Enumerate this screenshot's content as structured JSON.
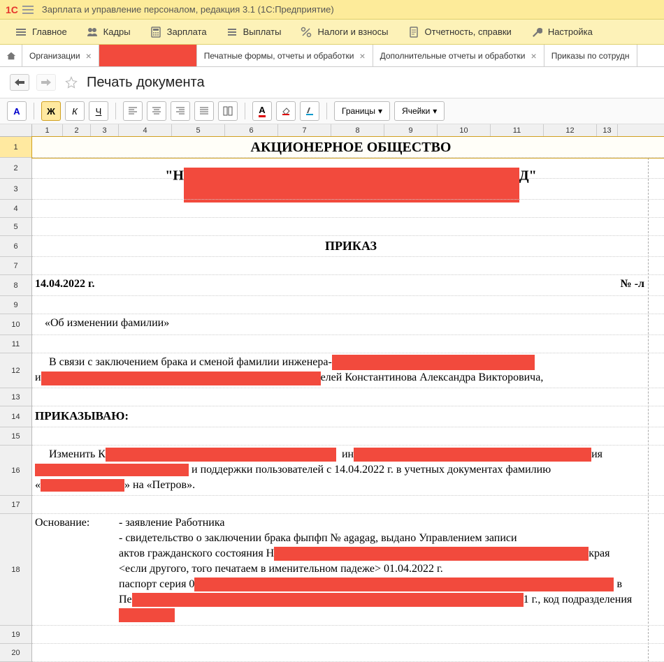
{
  "app": {
    "logo": "1C",
    "title": "Зарплата и управление персоналом, редакция 3.1  (1С:Предприятие)"
  },
  "mainmenu": [
    {
      "icon": "menu",
      "label": "Главное"
    },
    {
      "icon": "people",
      "label": "Кадры"
    },
    {
      "icon": "calc",
      "label": "Зарплата"
    },
    {
      "icon": "list",
      "label": "Выплаты"
    },
    {
      "icon": "percent",
      "label": "Налоги и взносы"
    },
    {
      "icon": "doc",
      "label": "Отчетность, справки"
    },
    {
      "icon": "wrench",
      "label": "Настройка"
    }
  ],
  "tabs": [
    {
      "label": "Организации",
      "closable": true,
      "active": false
    },
    {
      "label": "",
      "closable": false,
      "active": true,
      "redacted": true
    },
    {
      "label": "Печатные формы, отчеты и обработки",
      "closable": true,
      "active": false
    },
    {
      "label": "Дополнительные отчеты и обработки",
      "closable": true,
      "active": false
    },
    {
      "label": "Приказы по сотрудн",
      "closable": false,
      "active": false
    }
  ],
  "page": {
    "title": "Печать документа"
  },
  "toolbar": {
    "font_a": "A",
    "bold": "Ж",
    "italic": "К",
    "underline": "Ч",
    "borders": "Границы",
    "cells": "Ячейки"
  },
  "columns": [
    "1",
    "2",
    "3",
    "4",
    "5",
    "6",
    "7",
    "8",
    "9",
    "10",
    "11",
    "12",
    "13"
  ],
  "rows": [
    "1",
    "2",
    "3",
    "4",
    "5",
    "6",
    "7",
    "8",
    "9",
    "10",
    "11",
    "12",
    "13",
    "14",
    "15",
    "16",
    "17",
    "18",
    "19",
    "20"
  ],
  "doc": {
    "org_line1": "АКЦИОНЕРНОЕ ОБЩЕСТВО",
    "org_line2_before": "\"Н",
    "org_line2_after": "Д\"",
    "heading": "ПРИКАЗ",
    "date": "14.04.2022 г.",
    "number_label": "№ -л",
    "subject": "«Об изменении фамилии»",
    "para1_a": "В  связи  с  заключением  брака  и  сменой  фамилии  инженера-",
    "para1_b": "и",
    "para1_c": "елей Константинова Александра Викторовича,",
    "command": "ПРИКАЗЫВАЮ:",
    "para2_a": "Изменить  К",
    "para2_b": "ин",
    "para2_c": "ия",
    "para2_d": " и поддержки пользователей с 14.04.2022 г. в учетных документах фамилию",
    "para2_e": "«",
    "para2_f": "» на «Петров».",
    "basis_label": "Основание:",
    "basis1": "- заявление Работника",
    "basis2_a": "- свидетельство  о  заключении  брака  фыпфп  №  agagag,  выдано  Управлением  записи",
    "basis2_b": "актов  гражданского  состояния  Н",
    "basis2_c": "края",
    "basis2_d": "<если другого, того печатаем в именительном падеже> 01.04.2022 г.",
    "basis3_a": "паспорт  серия  0",
    "basis3_b": " в",
    "basis3_c": "Пе",
    "basis3_d": "1 г., код подразделения"
  }
}
